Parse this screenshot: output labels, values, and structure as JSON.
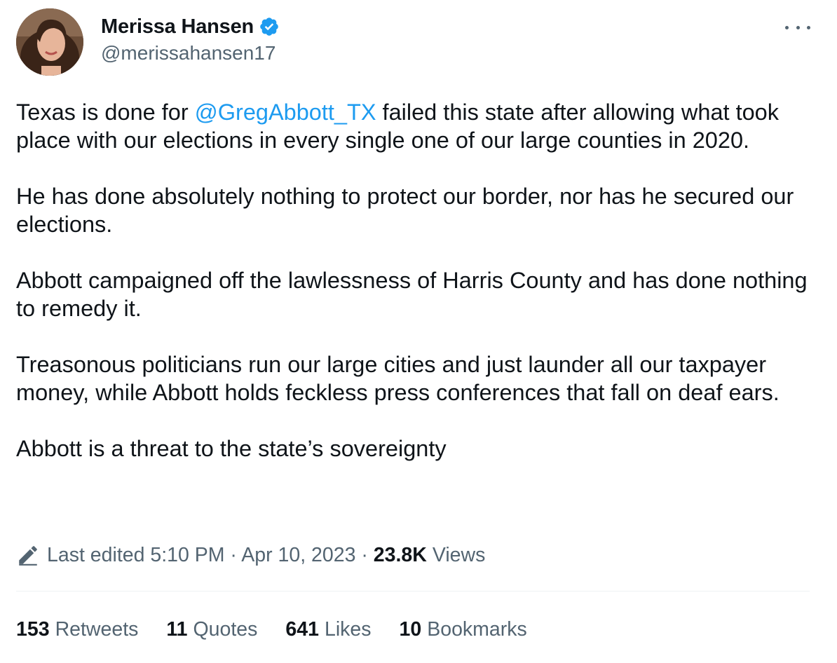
{
  "author": {
    "display_name": "Merissa Hansen",
    "handle": "@merissahansen17",
    "verified": true,
    "verified_color": "#1d9bf0"
  },
  "tweet": {
    "paragraphs": [
      {
        "before": "Texas is done for ",
        "mention": "@GregAbbott_TX",
        "after": " failed this state after allowing what took place with our elections in every single one of our large counties in 2020."
      },
      {
        "text": "He has done absolutely nothing to protect our border, nor has he secured our elections."
      },
      {
        "text": "Abbott campaigned off the lawlessness of Harris County and has done nothing to remedy it."
      },
      {
        "text": "Treasonous politicians run our large cities and just launder all our taxpayer money, while Abbott holds feckless press conferences that fall on deaf ears."
      },
      {
        "text": "Abbott is a threat to the state’s sovereignty"
      }
    ]
  },
  "meta": {
    "edited_label": "Last edited 5:10 PM · Apr 10, 2023 · ",
    "views_count": "23.8K",
    "views_label": "Views"
  },
  "stats": {
    "retweets": {
      "count": "153",
      "label": "Retweets"
    },
    "quotes": {
      "count": "11",
      "label": "Quotes"
    },
    "likes": {
      "count": "641",
      "label": "Likes"
    },
    "bookmarks": {
      "count": "10",
      "label": "Bookmarks"
    }
  },
  "icons": {
    "more": "more-horizontal-icon",
    "verified": "verified-badge-icon",
    "edit": "pencil-edit-icon"
  },
  "colors": {
    "link": "#1d9bf0",
    "secondary_text": "#536471",
    "primary_text": "#0f1419"
  }
}
